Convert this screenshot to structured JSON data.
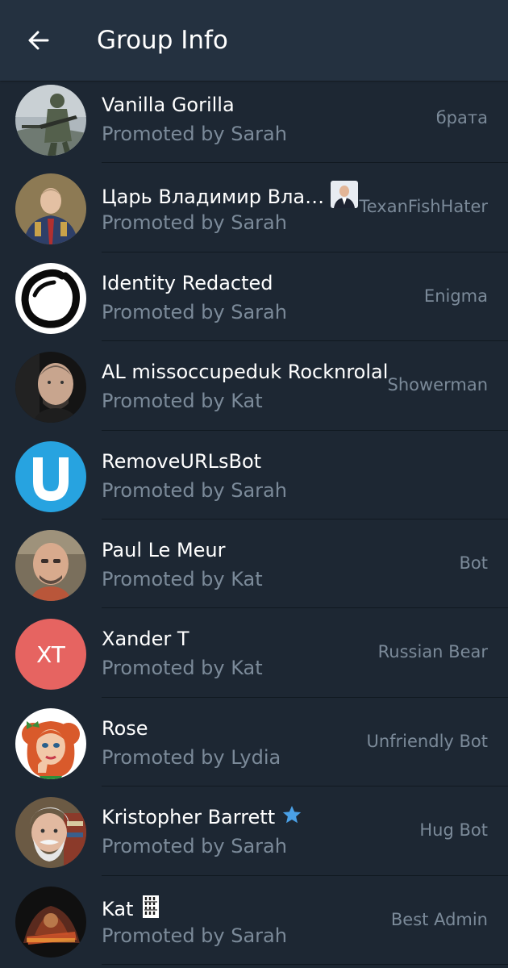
{
  "header": {
    "title": "Group Info",
    "back_icon": "arrow-left-icon"
  },
  "colors": {
    "background": "#1d2733",
    "header": "#243140",
    "subtext": "#7b8a99",
    "divider": "#101820",
    "bot_avatar": "#27a3e0",
    "initials_avatar": "#e66461",
    "star": "#4aa0e6"
  },
  "members": [
    {
      "name": "Vanilla Gorilla",
      "promoted": "Promoted by Sarah",
      "tag": "брата",
      "avatar": "soldier-photo"
    },
    {
      "name": "Царь Владимир Вла…",
      "promoted": "Promoted by Sarah",
      "tag": "TexanFishHater",
      "avatar": "tsar-portrait",
      "name_emoji": "man-in-suit-emoji"
    },
    {
      "name": "Identity Redacted",
      "promoted": "Promoted by Sarah",
      "tag": "Enigma",
      "avatar": "enso-circle"
    },
    {
      "name": "AL missoccupeduk Rocknrolal",
      "promoted": "Promoted by Kat",
      "tag": "Showerman",
      "avatar": "man-photo"
    },
    {
      "name": "RemoveURLsBot",
      "promoted": "Promoted by Sarah",
      "tag": "",
      "avatar": "letter-u"
    },
    {
      "name": "Paul Le Meur",
      "promoted": "Promoted by Kat",
      "tag": "Bot",
      "avatar": "bald-man-photo"
    },
    {
      "name": "Xander T",
      "promoted": "Promoted by Kat",
      "tag": "Russian Bear",
      "avatar": "initials",
      "initials": "XT"
    },
    {
      "name": "Rose",
      "promoted": "Promoted by Lydia",
      "tag": "Unfriendly Bot",
      "avatar": "cartoon-woman"
    },
    {
      "name": "Kristopher Barrett",
      "promoted": "Promoted by Sarah",
      "tag": "Hug Bot",
      "avatar": "bearded-man-photo",
      "name_emoji": "star-icon"
    },
    {
      "name": "Kat",
      "promoted": "Promoted by Sarah",
      "tag": "Best Admin",
      "avatar": "poster-art",
      "name_emoji": "custom-emoji"
    }
  ]
}
